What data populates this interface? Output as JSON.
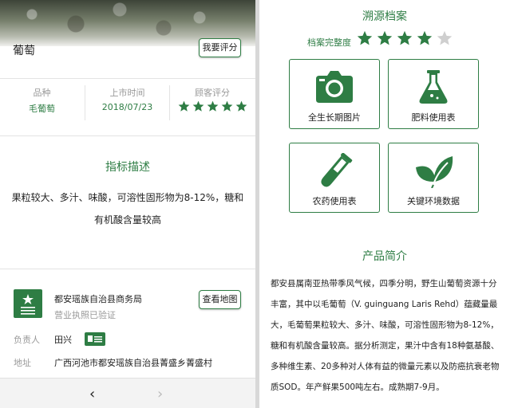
{
  "left": {
    "product_name": "葡萄",
    "rate_button": "我要评分",
    "info": {
      "variety_label": "品种",
      "variety_value": "毛葡萄",
      "launch_label": "上市时间",
      "launch_value": "2018/07/23",
      "rating_label": "顾客评分",
      "rating_value": 5
    },
    "indicator_title": "指标描述",
    "indicator_text": "果粒较大、多汁、味酸，可溶性固形物为8-12%，糖和有机酸含量较高",
    "org": {
      "name": "都安瑶族自治县商务局",
      "license_status": "营业执照已验证",
      "map_button": "查看地图",
      "owner_label": "负责人",
      "owner_value": "田兴",
      "address_label": "地址",
      "address_value": "广西河池市都安瑶族自治县菁盛乡菁盛村"
    },
    "nav": {
      "back": "‹",
      "forward": "›"
    }
  },
  "right": {
    "trace_title": "溯源档案",
    "completeness_label": "档案完整度",
    "completeness_stars": 4,
    "completeness_max": 5,
    "cards": [
      {
        "label": "全生长期图片",
        "icon": "camera-icon"
      },
      {
        "label": "肥料使用表",
        "icon": "flask-icon"
      },
      {
        "label": "农药使用表",
        "icon": "test-tube-icon"
      },
      {
        "label": "关键环境数据",
        "icon": "leaves-icon"
      }
    ],
    "intro_title": "产品简介",
    "intro_text": "都安县属南亚热带季风气候，四季分明，野生山葡萄资源十分丰富，其中以毛葡萄（V. guinguang Laris Rehd）蕴藏量最大，毛葡萄果粒较大、多汁、味酸，可溶性固形物为8-12%，糖和有机酸含量较高。据分析测定，果汁中含有18种氨基酸、多种维生素、20多种对人体有益的微量元素以及防癌抗衰老物质SOD。年产鲜果500吨左右。成熟期7-9月。"
  },
  "colors": {
    "accent": "#2e7d44",
    "muted": "#999999",
    "star_off": "#cfcfcf"
  }
}
